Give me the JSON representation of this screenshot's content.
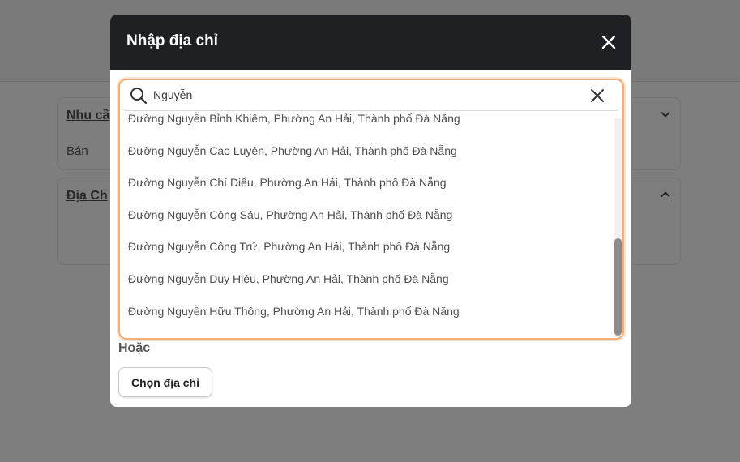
{
  "background": {
    "cards": [
      {
        "title": "Nhu cầ",
        "value": "Bán"
      },
      {
        "title": "Địa Ch",
        "value": ""
      }
    ]
  },
  "modal": {
    "title": "Nhập địa chỉ",
    "search": {
      "value": "Nguyễn",
      "placeholder": ""
    },
    "results": [
      "Đường Nguyễn Bỉnh Khiêm, Phường An Hải, Thành phố Đà Nẵng",
      "Đường Nguyễn Cao Luyện, Phường An Hải, Thành phố Đà Nẵng",
      "Đường Nguyễn Chí Diểu, Phường An Hải, Thành phố Đà Nẵng",
      "Đường Nguyễn Công Sáu, Phường An Hải, Thành phố Đà Nẵng",
      "Đường Nguyễn Công Trứ, Phường An Hải, Thành phố Đà Nẵng",
      "Đường Nguyễn Duy Hiệu, Phường An Hải, Thành phố Đà Nẵng",
      "Đường Nguyễn Hữu Thông, Phường An Hải, Thành phố Đà Nẵng"
    ],
    "or_label": "Hoặc",
    "choose_button": "Chọn địa chỉ"
  },
  "colors": {
    "modal_header": "#1e2023",
    "focus_border": "#f4b07a",
    "overlay": "#7e7e7e"
  },
  "icons": {
    "close": "close-icon",
    "search": "search-icon",
    "clear": "clear-icon",
    "chevron_down": "chevron-down-icon",
    "chevron_up": "chevron-up-icon"
  }
}
